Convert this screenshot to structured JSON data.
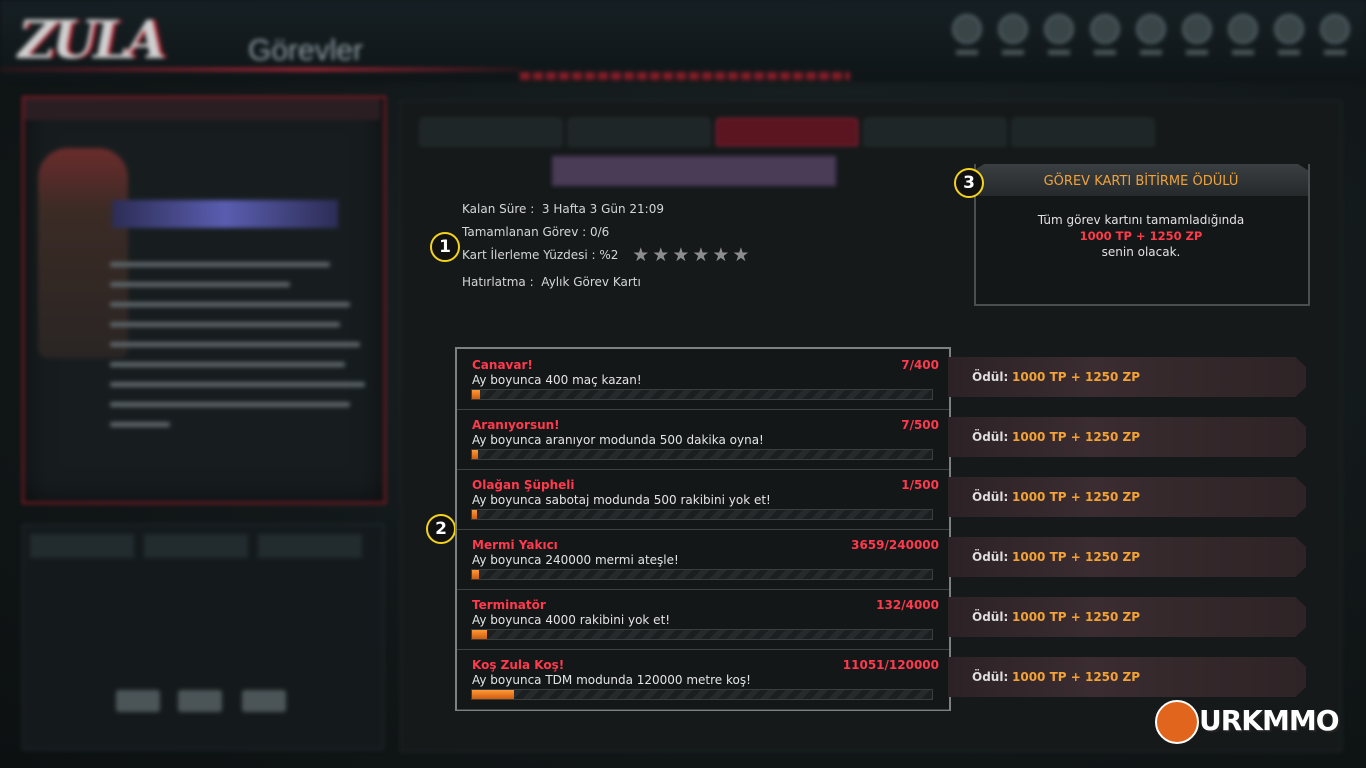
{
  "info": {
    "remaining_label": "Kalan Süre :",
    "remaining_value": "3 Hafta 3 Gün 21:09",
    "completed_label": "Tamamlanan Görev :",
    "completed_value": "0/6",
    "progress_label": "Kart İlerleme Yüzdesi :",
    "progress_value": "%2",
    "stars": "★★★★★★",
    "reminder_label": "Hatırlatma :",
    "reminder_value": "Aylık Görev Kartı"
  },
  "markers": [
    "1",
    "2",
    "3"
  ],
  "reward": {
    "title": "GÖREV KARTI BİTİRME ÖDÜLÜ",
    "line1": "Tüm görev kartını tamamladığında",
    "amount": "1000 TP + 1250 ZP",
    "line3": "senin olacak."
  },
  "missions": [
    {
      "name": "Canavar!",
      "desc": "Ay boyunca 400 maç kazan!",
      "count": "7/400",
      "progress": 0.0175,
      "reward_label": "Ödül:",
      "reward": "1000 TP + 1250 ZP"
    },
    {
      "name": "Aranıyorsun!",
      "desc": "Ay boyunca aranıyor modunda 500 dakika oyna!",
      "count": "7/500",
      "progress": 0.014,
      "reward_label": "Ödül:",
      "reward": "1000 TP + 1250 ZP"
    },
    {
      "name": "Olağan Şüpheli",
      "desc": "Ay boyunca sabotaj modunda 500 rakibini yok et!",
      "count": "1/500",
      "progress": 0.002,
      "reward_label": "Ödül:",
      "reward": "1000 TP + 1250 ZP"
    },
    {
      "name": "Mermi Yakıcı",
      "desc": "Ay boyunca 240000 mermi ateşle!",
      "count": "3659/240000",
      "progress": 0.015,
      "reward_label": "Ödül:",
      "reward": "1000 TP + 1250 ZP"
    },
    {
      "name": "Terminatör",
      "desc": "Ay boyunca 4000 rakibini yok et!",
      "count": "132/4000",
      "progress": 0.033,
      "reward_label": "Ödül:",
      "reward": "1000 TP + 1250 ZP"
    },
    {
      "name": "Koş Zula Koş!",
      "desc": "Ay boyunca TDM modunda 120000 metre koş!",
      "count": "11051/120000",
      "progress": 0.092,
      "reward_label": "Ödül:",
      "reward": "1000 TP + 1250 ZP"
    }
  ],
  "watermark": "URKMMO",
  "colors": {
    "mission_title": "#ff3a4d",
    "reward_value": "#f2a236",
    "marker_border": "#f5d21c",
    "progress_fill": "#e8741c"
  }
}
